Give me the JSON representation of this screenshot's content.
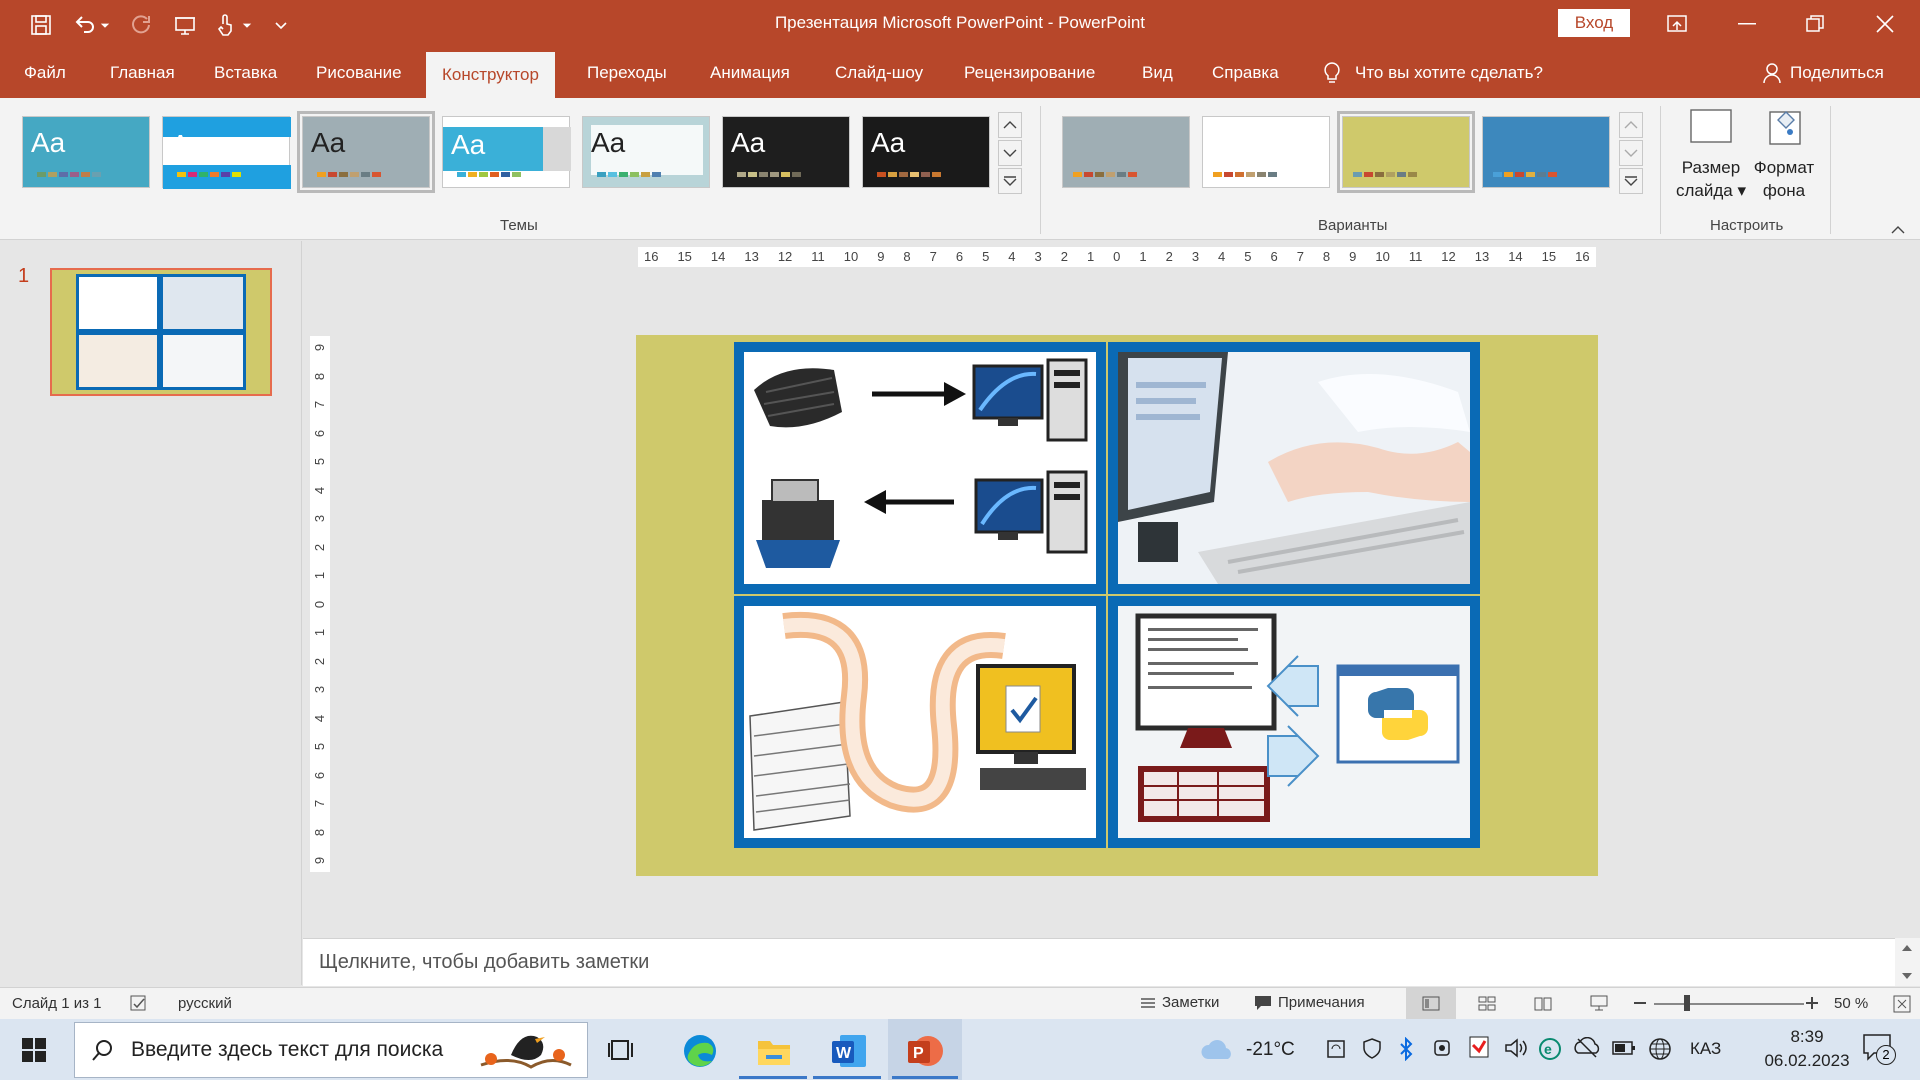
{
  "window": {
    "title": "Презентация Microsoft PowerPoint  -  PowerPoint",
    "login_label": "Вход"
  },
  "tabs": [
    {
      "label": "Файл"
    },
    {
      "label": "Главная"
    },
    {
      "label": "Вставка"
    },
    {
      "label": "Рисование"
    },
    {
      "label": "Конструктор"
    },
    {
      "label": "Переходы"
    },
    {
      "label": "Анимация"
    },
    {
      "label": "Слайд-шоу"
    },
    {
      "label": "Рецензирование"
    },
    {
      "label": "Вид"
    },
    {
      "label": "Справка"
    }
  ],
  "tell_me": "Что вы хотите сделать?",
  "share": "Поделиться",
  "ribbon": {
    "themes_label": "Темы",
    "variants_label": "Варианты",
    "customize_label": "Настроить",
    "theme_text": "Aa",
    "slide_size_line1": "Размер",
    "slide_size_line2": "слайда",
    "format_bg_line1": "Формат",
    "format_bg_line2": "фона"
  },
  "slides_pane": {
    "slide_number": "1"
  },
  "rulers": {
    "horizontal": [
      "16",
      "15",
      "14",
      "13",
      "12",
      "11",
      "10",
      "9",
      "8",
      "7",
      "6",
      "5",
      "4",
      "3",
      "2",
      "1",
      "0",
      "1",
      "2",
      "3",
      "4",
      "5",
      "6",
      "7",
      "8",
      "9",
      "10",
      "11",
      "12",
      "13",
      "14",
      "15",
      "16"
    ],
    "vertical": [
      "9",
      "8",
      "7",
      "6",
      "5",
      "4",
      "3",
      "2",
      "1",
      "0",
      "1",
      "2",
      "3",
      "4",
      "5",
      "6",
      "7",
      "8",
      "9"
    ]
  },
  "notes_placeholder": "Щелкните, чтобы добавить заметки",
  "status": {
    "slide_info": "Слайд 1 из 1",
    "language": "русский",
    "notes": "Заметки",
    "comments": "Примечания",
    "zoom": "50 %"
  },
  "taskbar": {
    "search_placeholder": "Введите здесь текст для поиска",
    "weather": "-21°C",
    "lang": "КАЗ",
    "time": "8:39",
    "date": "06.02.2023",
    "notif_count": "2"
  },
  "colors": {
    "accent": "#b7472a",
    "slide_bg": "#cfc96b",
    "picture_border": "#0a6ab5"
  }
}
